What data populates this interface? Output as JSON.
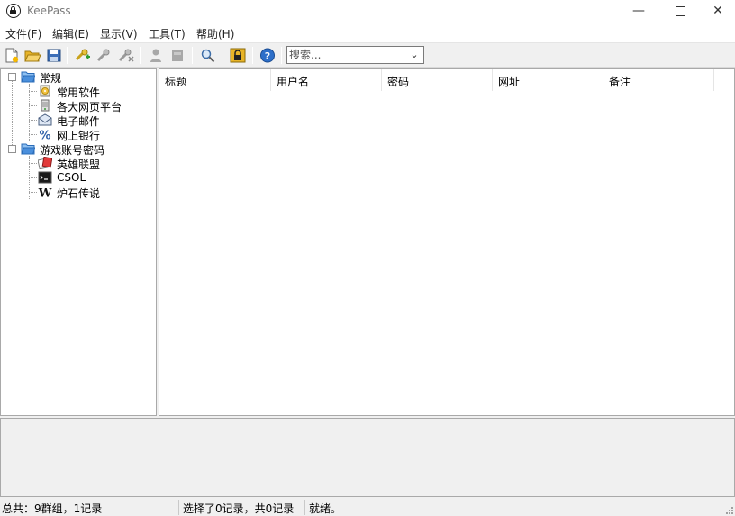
{
  "window": {
    "title": "KeePass"
  },
  "menu": [
    "文件(F)",
    "编辑(E)",
    "显示(V)",
    "工具(T)",
    "帮助(H)"
  ],
  "search": {
    "placeholder": "搜索..."
  },
  "tree": {
    "groups": [
      {
        "label": "常规",
        "children": [
          "常用软件",
          "各大网页平台",
          "电子邮件",
          "网上银行"
        ]
      },
      {
        "label": "游戏账号密码",
        "children": [
          "英雄联盟",
          "CSOL",
          "炉石传说"
        ]
      }
    ]
  },
  "columns": [
    "标题",
    "用户名",
    "密码",
    "网址",
    "备注"
  ],
  "status": {
    "total": "总共：9群组，1记录",
    "selected": "选择了0记录，共0记录",
    "state": "就绪。"
  },
  "colors": {
    "folder": "#3b7fd4",
    "accent": "#e8b428",
    "help": "#2d6fc9"
  }
}
